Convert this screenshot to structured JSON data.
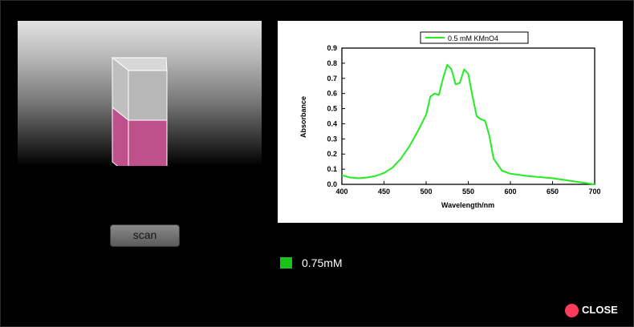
{
  "sample": {
    "liquid_color": "#c0508c"
  },
  "controls": {
    "scan_label": "scan",
    "close_label": "CLOSE"
  },
  "legend": {
    "swatch_color": "#19c419",
    "label": "0.75mM"
  },
  "chart_data": {
    "type": "line",
    "xlabel": "Wavelength/nm",
    "ylabel": "Absorbance",
    "xlim": [
      400,
      700
    ],
    "ylim": [
      0,
      0.9
    ],
    "xticks": [
      400,
      450,
      500,
      550,
      600,
      650,
      700
    ],
    "yticks": [
      0.0,
      0.1,
      0.2,
      0.3,
      0.4,
      0.5,
      0.6,
      0.7,
      0.8,
      0.9
    ],
    "legend_position": "top",
    "series": [
      {
        "name": "0.5 mM KMnO4",
        "color": "#22ee22",
        "x": [
          400,
          410,
          420,
          430,
          440,
          450,
          460,
          470,
          480,
          490,
          500,
          505,
          510,
          515,
          520,
          525,
          530,
          535,
          540,
          545,
          550,
          555,
          560,
          565,
          570,
          575,
          580,
          590,
          600,
          620,
          650,
          675,
          700
        ],
        "y": [
          0.06,
          0.045,
          0.04,
          0.045,
          0.055,
          0.075,
          0.11,
          0.17,
          0.25,
          0.35,
          0.46,
          0.58,
          0.6,
          0.59,
          0.7,
          0.79,
          0.76,
          0.66,
          0.67,
          0.76,
          0.73,
          0.58,
          0.45,
          0.43,
          0.42,
          0.32,
          0.17,
          0.09,
          0.07,
          0.055,
          0.04,
          0.02,
          0.0
        ]
      }
    ]
  }
}
